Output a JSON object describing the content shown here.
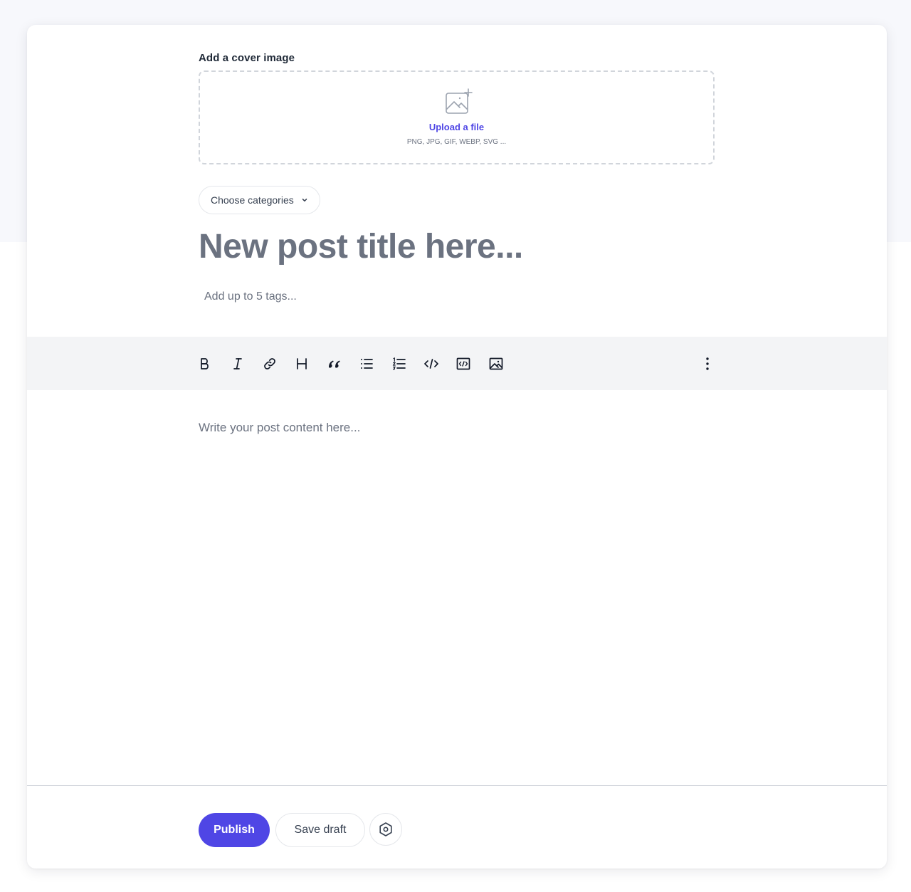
{
  "cover": {
    "label": "Add a cover image",
    "upload_link": "Upload a file",
    "hint": "PNG, JPG, GIF, WEBP, SVG ..."
  },
  "categories": {
    "button_label": "Choose categories"
  },
  "post": {
    "title_placeholder": "New post title here...",
    "tags_placeholder": "Add up to 5 tags...",
    "content_placeholder": "Write your post content here..."
  },
  "toolbar": {
    "buttons": [
      {
        "name": "bold-icon",
        "title": "Bold"
      },
      {
        "name": "italic-icon",
        "title": "Italic"
      },
      {
        "name": "link-icon",
        "title": "Link"
      },
      {
        "name": "heading-icon",
        "title": "Heading"
      },
      {
        "name": "quote-icon",
        "title": "Quote"
      },
      {
        "name": "bullet-list-icon",
        "title": "Bulleted list"
      },
      {
        "name": "numbered-list-icon",
        "title": "Numbered list"
      },
      {
        "name": "code-icon",
        "title": "Code"
      },
      {
        "name": "code-block-icon",
        "title": "Code block"
      },
      {
        "name": "image-icon",
        "title": "Image"
      },
      {
        "name": "more-options-icon",
        "title": "More options"
      }
    ]
  },
  "actions": {
    "publish_label": "Publish",
    "save_draft_label": "Save draft"
  },
  "colors": {
    "accent": "#4f46e5",
    "toolbar_bg": "#f3f4f6",
    "page_bg": "#f7f8fc"
  }
}
